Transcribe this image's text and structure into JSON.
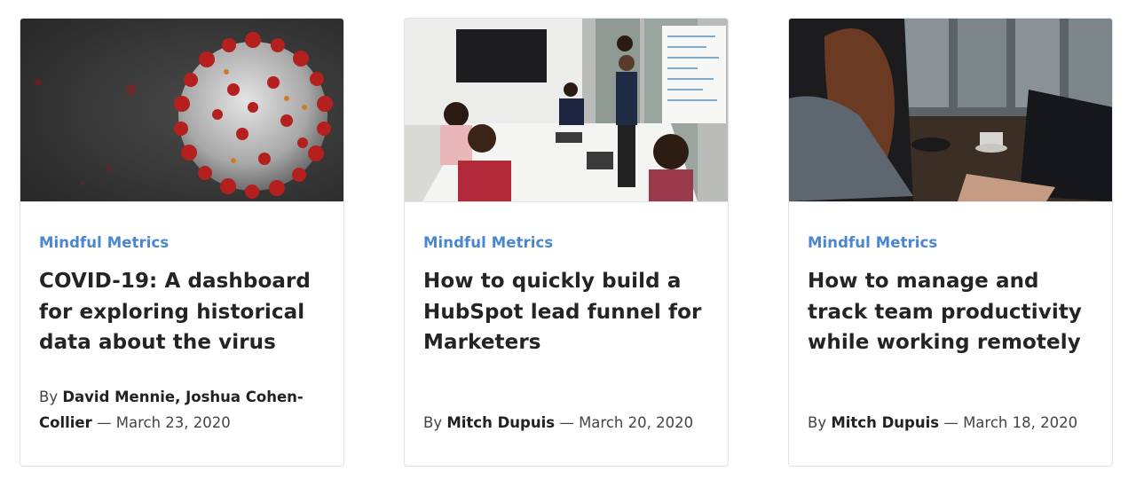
{
  "cards": [
    {
      "category": "Mindful Metrics",
      "title": "COVID-19: A dashboard for exploring historical data about the virus",
      "by": "By",
      "authors": "David Mennie, Joshua Cohen-Collier",
      "separator": "—",
      "date": "March 23, 2020",
      "image": "coronavirus-illustration"
    },
    {
      "category": "Mindful Metrics",
      "title": "How to quickly build a HubSpot lead funnel for Marketers",
      "by": "By",
      "authors": "Mitch Dupuis",
      "separator": "—",
      "date": "March 20, 2020",
      "image": "team-meeting-photo"
    },
    {
      "category": "Mindful Metrics",
      "title": "How to manage and track team productivity while working remotely",
      "by": "By",
      "authors": "Mitch Dupuis",
      "separator": "—",
      "date": "March 18, 2020",
      "image": "remote-worker-laptop-photo"
    }
  ],
  "colors": {
    "category": "#4a86d1",
    "title": "#242424",
    "border": "#dfe2e6"
  }
}
